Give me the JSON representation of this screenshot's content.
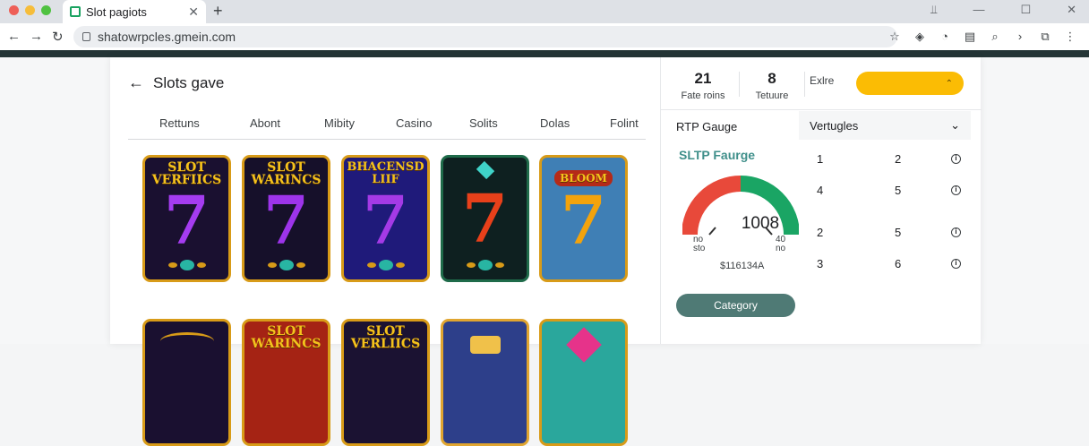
{
  "browser": {
    "tab_title": "Slot pagiots",
    "tab_close": "✕",
    "new_tab": "+",
    "window_controls": [
      "⫫",
      "—",
      "☐",
      "✕"
    ],
    "url": "shatowrpcles.gmein.com",
    "traffic_lights": [
      "#ee5f57",
      "#f6bd3a",
      "#4fc241"
    ]
  },
  "page": {
    "back_arrow": "←",
    "title": "Slots gave",
    "categories": [
      "Rettuns",
      "Abont",
      "Mibity",
      "Casino",
      "Solits",
      "Dolas",
      "Folint"
    ]
  },
  "tiles": [
    {
      "title_line1": "SLOT",
      "title_line2": "VERFIICS",
      "seven": "7",
      "bg": "#1a1030",
      "seven_color": "#a53cf0"
    },
    {
      "title_line1": "SLOT",
      "title_line2": "WARINCS",
      "seven": "7",
      "bg": "#16102a",
      "seven_color": "#9d34ea"
    },
    {
      "title_line1": "BHACENSD",
      "title_line2": "LIIF",
      "seven": "7",
      "bg": "#1f1a7a",
      "seven_color": "#a43ae6"
    },
    {
      "title_line1": "",
      "title_line2": "",
      "seven": "7",
      "bg": "#0e2020",
      "seven_color": "#e8401a"
    },
    {
      "title_line1": "BLOOM",
      "title_line2": "",
      "seven": "7",
      "bg": "#3f7fb5",
      "seven_color": "#f3a30c"
    }
  ],
  "tiles_row2": [
    {
      "title_line1": "",
      "title_line2": "",
      "bg": "#1a1030"
    },
    {
      "title_line1": "SLOT",
      "title_line2": "WARINCS",
      "bg": "#a52314"
    },
    {
      "title_line1": "SLOT",
      "title_line2": "VERLIICS",
      "bg": "#1b1232"
    },
    {
      "title_line1": "",
      "title_line2": "",
      "bg": "#2d3f8a"
    },
    {
      "title_line1": "",
      "title_line2": "",
      "bg": "#2aa79c"
    }
  ],
  "stats": [
    {
      "value": "21",
      "label": "Fate roins"
    },
    {
      "value": "8",
      "label": "Tetuure"
    }
  ],
  "sort": {
    "label": "Exlre",
    "button_caret": "⌃",
    "color": "#fbbc04"
  },
  "rtp_heading": "RTP Gauge",
  "variations": {
    "heading": "Vertugles",
    "caret": "⌄",
    "info_icon": "i",
    "rows": [
      {
        "a": "1",
        "b": "2"
      },
      {
        "a": "4",
        "b": "5"
      },
      {
        "a": "2",
        "b": "5"
      },
      {
        "a": "3",
        "b": "6"
      }
    ]
  },
  "gauge": {
    "title": "SLTP Faurge",
    "value": "1008",
    "min_label_1": "no",
    "min_label_2": "sto",
    "max_label_1": "40",
    "max_label_2": "no",
    "footer": "$116134A",
    "fraction": 0.5,
    "colors": {
      "low": "#e8493a",
      "high": "#1aa564",
      "title": "#3f8f8a"
    }
  },
  "category_button": "Category"
}
